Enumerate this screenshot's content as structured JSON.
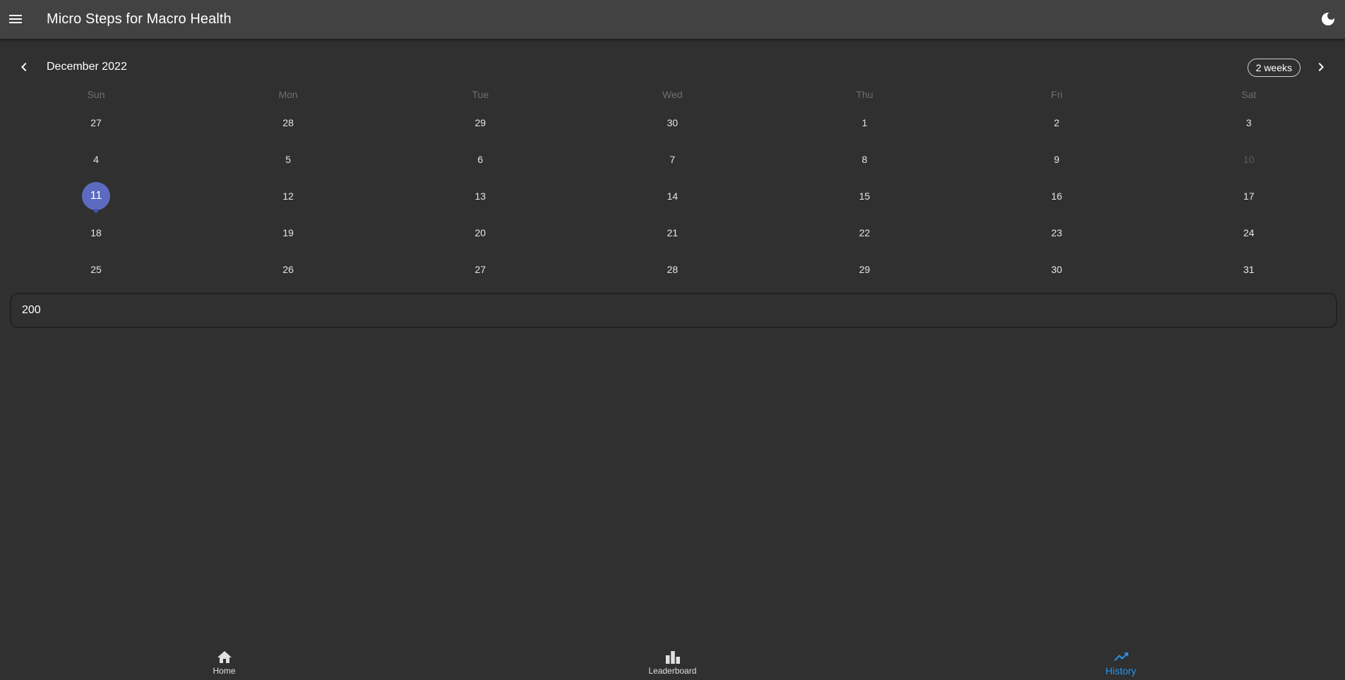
{
  "appbar": {
    "title": "Micro Steps for Macro Health",
    "menu_icon": "menu-icon",
    "theme_icon": "moon-icon"
  },
  "calendar": {
    "month_title": "December 2022",
    "format_button_label": "2 weeks",
    "weekdays": [
      "Sun",
      "Mon",
      "Tue",
      "Wed",
      "Thu",
      "Fri",
      "Sat"
    ],
    "weeks": [
      [
        {
          "d": "27"
        },
        {
          "d": "28"
        },
        {
          "d": "29"
        },
        {
          "d": "30"
        },
        {
          "d": "1"
        },
        {
          "d": "2"
        },
        {
          "d": "3"
        }
      ],
      [
        {
          "d": "4"
        },
        {
          "d": "5"
        },
        {
          "d": "6"
        },
        {
          "d": "7"
        },
        {
          "d": "8"
        },
        {
          "d": "9"
        },
        {
          "d": "10",
          "disabled": true
        }
      ],
      [
        {
          "d": "11",
          "selected": true,
          "marker": true
        },
        {
          "d": "12"
        },
        {
          "d": "13"
        },
        {
          "d": "14"
        },
        {
          "d": "15"
        },
        {
          "d": "16"
        },
        {
          "d": "17"
        }
      ],
      [
        {
          "d": "18"
        },
        {
          "d": "19"
        },
        {
          "d": "20"
        },
        {
          "d": "21"
        },
        {
          "d": "22"
        },
        {
          "d": "23"
        },
        {
          "d": "24"
        }
      ],
      [
        {
          "d": "25"
        },
        {
          "d": "26"
        },
        {
          "d": "27"
        },
        {
          "d": "28"
        },
        {
          "d": "29"
        },
        {
          "d": "30"
        },
        {
          "d": "31"
        }
      ]
    ]
  },
  "event_value": "200",
  "bottom_nav": {
    "items": [
      {
        "label": "Home",
        "icon": "home-icon",
        "active": false
      },
      {
        "label": "Leaderboard",
        "icon": "leaderboard-icon",
        "active": false
      },
      {
        "label": "History",
        "icon": "trending-up-icon",
        "active": true
      }
    ]
  },
  "colors": {
    "background": "#303030",
    "appbar": "#424242",
    "selected_day": "#5c6bc0",
    "active_nav": "#2196f3"
  }
}
